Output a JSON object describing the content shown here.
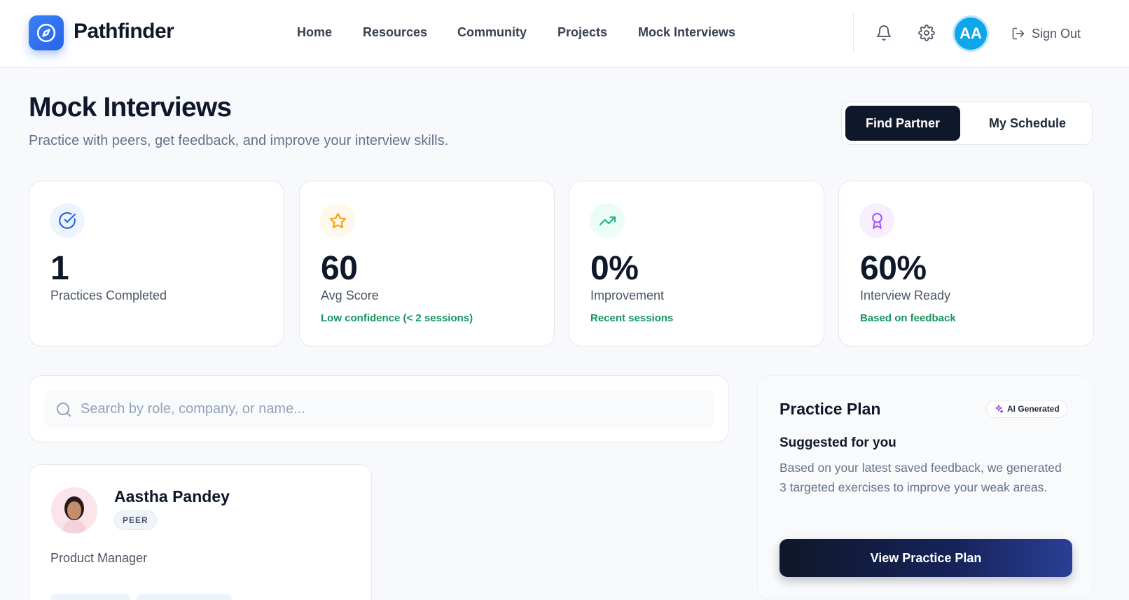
{
  "brand": {
    "name": "Pathfinder"
  },
  "nav": {
    "items": [
      {
        "label": "Home"
      },
      {
        "label": "Resources"
      },
      {
        "label": "Community"
      },
      {
        "label": "Projects"
      },
      {
        "label": "Mock Interviews"
      }
    ]
  },
  "header": {
    "avatar_initials": "AA",
    "signout_label": "Sign Out",
    "icons": [
      "bell-icon",
      "gear-icon",
      "signout-icon"
    ]
  },
  "page": {
    "title": "Mock Interviews",
    "subtitle": "Practice with peers, get feedback, and improve your interview skills.",
    "segments": {
      "active": "Find Partner",
      "other": "My Schedule"
    }
  },
  "stats": [
    {
      "value": "1",
      "label": "Practices Completed",
      "note": "",
      "icon": "check-circle-icon",
      "color": "#2563eb"
    },
    {
      "value": "60",
      "label": "Avg Score",
      "note": "Low confidence (< 2 sessions)",
      "icon": "star-icon",
      "color": "#f59e0b"
    },
    {
      "value": "0%",
      "label": "Improvement",
      "note": "Recent sessions",
      "icon": "trending-up-icon",
      "color": "#10b981"
    },
    {
      "value": "60%",
      "label": "Interview Ready",
      "note": "Based on feedback",
      "icon": "award-icon",
      "color": "#a855f7"
    }
  ],
  "search": {
    "placeholder": "Search by role, company, or name...",
    "value": ""
  },
  "profile": {
    "name": "Aastha Pandey",
    "badge": "PEER",
    "role": "Product Manager"
  },
  "plan": {
    "title": "Practice Plan",
    "badge": "AI Generated",
    "subtitle": "Suggested for you",
    "description": "Based on your latest saved feedback, we generated 3 targeted exercises to improve your weak areas.",
    "button_label": "View Practice Plan"
  }
}
